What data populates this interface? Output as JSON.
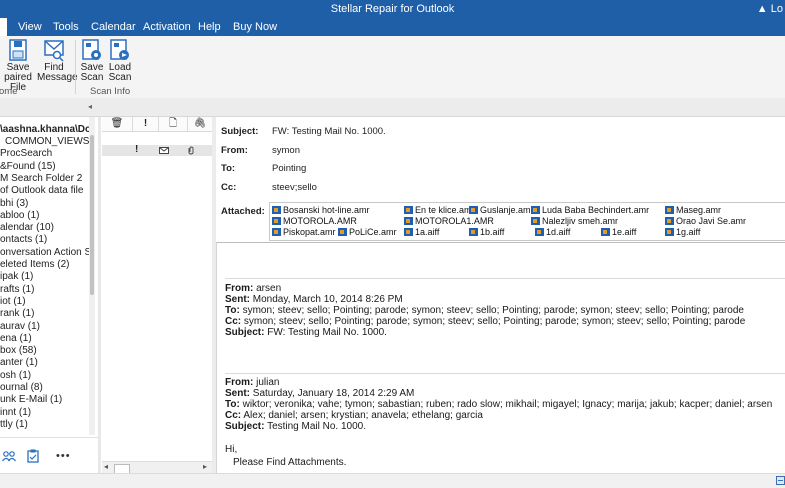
{
  "window": {
    "title": "Stellar Repair for Outlook",
    "login_fragment": "Lo"
  },
  "menu": {
    "items": [
      "View",
      "Tools",
      "Calendar",
      "Activation",
      "Help",
      "Buy Now"
    ]
  },
  "ribbon": {
    "buttons": [
      {
        "line1": "Save",
        "line2": "paired File",
        "icon": "save-icon"
      },
      {
        "line1": "Find",
        "line2": "Message",
        "icon": "find-message-icon"
      },
      {
        "line1": "Save",
        "line2": "Scan",
        "icon": "save-scan-icon"
      },
      {
        "line1": "Load",
        "line2": "Scan",
        "icon": "load-scan-icon"
      }
    ],
    "groups": [
      "ome",
      "Scan Info"
    ]
  },
  "tree": {
    "root": "\\aashna.khanna\\Downl",
    "nodes": [
      "COMMON_VIEWS",
      "ProcSearch",
      "&Found (15)",
      "M Search Folder 2",
      "of Outlook data file",
      "bhi (3)",
      "abloo (1)",
      "alendar (10)",
      "ontacts (1)",
      "onversation Action Setti",
      "eleted Items (2)",
      "ipak (1)",
      "rafts (1)",
      "iot (1)",
      "rank (1)",
      "aurav (1)",
      "ena (1)",
      "box (58)",
      "anter (1)",
      "osh (1)",
      "ournal (8)",
      "unk E-Mail (1)",
      "innt (1)",
      "ttly (1)"
    ],
    "footer_icons": [
      "people-icon",
      "tasks-icon",
      "more-icon"
    ],
    "more_label": "•••"
  },
  "list": {
    "headers": [
      "trash-icon",
      "!",
      "doc-icon",
      "attach-icon"
    ],
    "row": {
      "importance": "!",
      "icons": [
        "envelope-icon",
        "attach-icon"
      ]
    }
  },
  "header": {
    "subject_label": "Subject:",
    "subject": "FW: Testing Mail No. 1000.",
    "from_label": "From:",
    "from": "symon",
    "to_label": "To:",
    "to": "Pointing",
    "cc_label": "Cc:",
    "cc": "steev;sello",
    "attached_label": "Attached:",
    "attachments": [
      "Bosanski hot-line.amr",
      "En te klice.amr",
      "Guslanje.amr",
      "Luda Baba Bechindert.amr",
      "Maseg.amr",
      "MOTOROLA.AMR",
      "MOTOROLA1.AMR",
      "Nalezljiv smeh.amr",
      "Orao Javi Se.amr",
      "Piskopat.amr",
      "PoLiCe.amr",
      "1a.aiff",
      "1b.aiff",
      "1d.aiff",
      "1e.aiff",
      "1g.aiff"
    ]
  },
  "body": {
    "block1": {
      "from_label": "From:",
      "from": "arsen",
      "sent_label": "Sent:",
      "sent": "Monday, March 10, 2014 8:26 PM",
      "to_label": "To:",
      "to": "symon; steev; sello; Pointing; parode; symon; steev; sello; Pointing; parode; symon; steev; sello; Pointing; parode",
      "cc_label": "Cc:",
      "cc": "symon; steev; sello; Pointing; parode; symon; steev; sello; Pointing; parode; symon; steev; sello; Pointing; parode",
      "subject_label": "Subject:",
      "subject": "FW: Testing Mail No. 1000."
    },
    "block2": {
      "from_label": "From:",
      "from": "julian",
      "sent_label": "Sent:",
      "sent": "Saturday, January 18, 2014 2:29 AM",
      "to_label": "To:",
      "to": "wiktor; veronika; vahe; tymon; sabastian; ruben; rado slow; mikhail; migayel; Ignacy; marija; jakub; kacper; daniel; arsen",
      "cc_label": "Cc:",
      "cc": "Alex; daniel; arsen; krystian; anavela; ethelang; garcia",
      "subject_label": "Subject:",
      "subject": "Testing Mail No. 1000."
    },
    "greeting": "Hi,",
    "message": "Please Find Attachments."
  },
  "colors": {
    "title_bar": "#1f5fa8",
    "accent": "#1d5fb5"
  }
}
